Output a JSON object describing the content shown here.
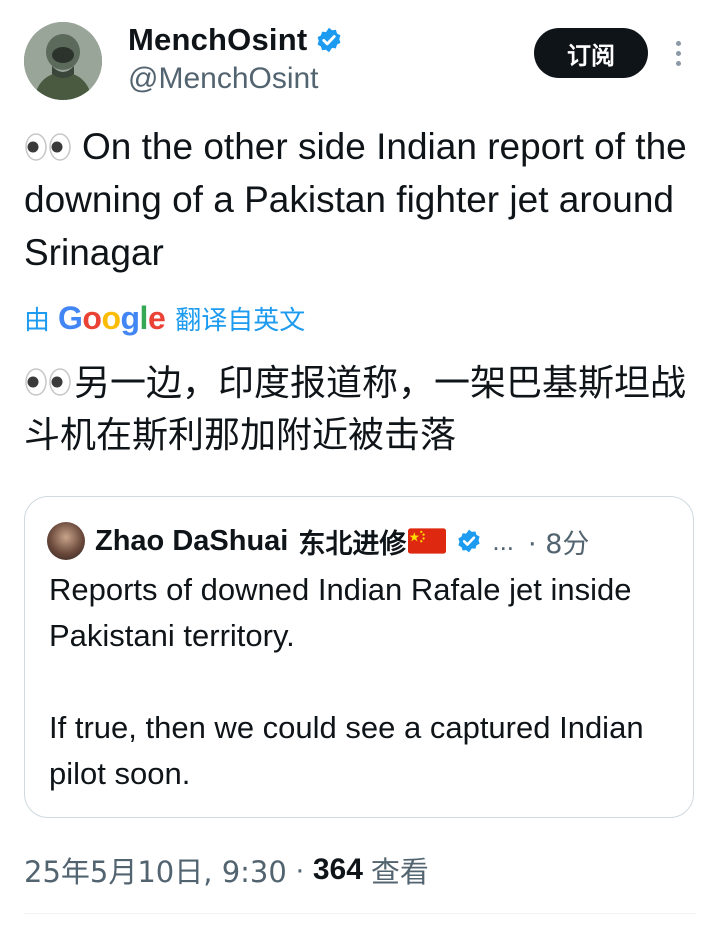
{
  "author": {
    "display_name": "MenchOsint",
    "handle": "@MenchOsint",
    "verified": true,
    "avatar_icon": "avatar-pilot-photo"
  },
  "subscribe_button": {
    "label": "订阅"
  },
  "tweet": {
    "emoji": "eyes-emoji",
    "text": "On the other side Indian report of the downing of a Pakistan fighter jet around Srinagar"
  },
  "translation": {
    "prefix": "由",
    "provider": "Google",
    "suffix": "翻译自英文",
    "text": "另一边，印度报道称，一架巴基斯坦战斗机在斯利那加附近被击落"
  },
  "quoted_tweet": {
    "author_name": "Zhao DaShuai",
    "author_name_cn": "东北进修",
    "flag": "china-flag",
    "verified": true,
    "ellipsis": "...",
    "time": "· 8分",
    "paragraphs": [
      "Reports of downed Indian Rafale jet inside Pakistani territory.",
      "If true, then we could see a captured Indian pilot soon."
    ]
  },
  "meta": {
    "date": "25年5月10日, 9:30",
    "separator": "·",
    "views_count": "364",
    "views_label": "查看"
  },
  "colors": {
    "text": "#0f1419",
    "secondary": "#536471",
    "accent": "#1d9bf0",
    "border": "#cfd9de"
  }
}
